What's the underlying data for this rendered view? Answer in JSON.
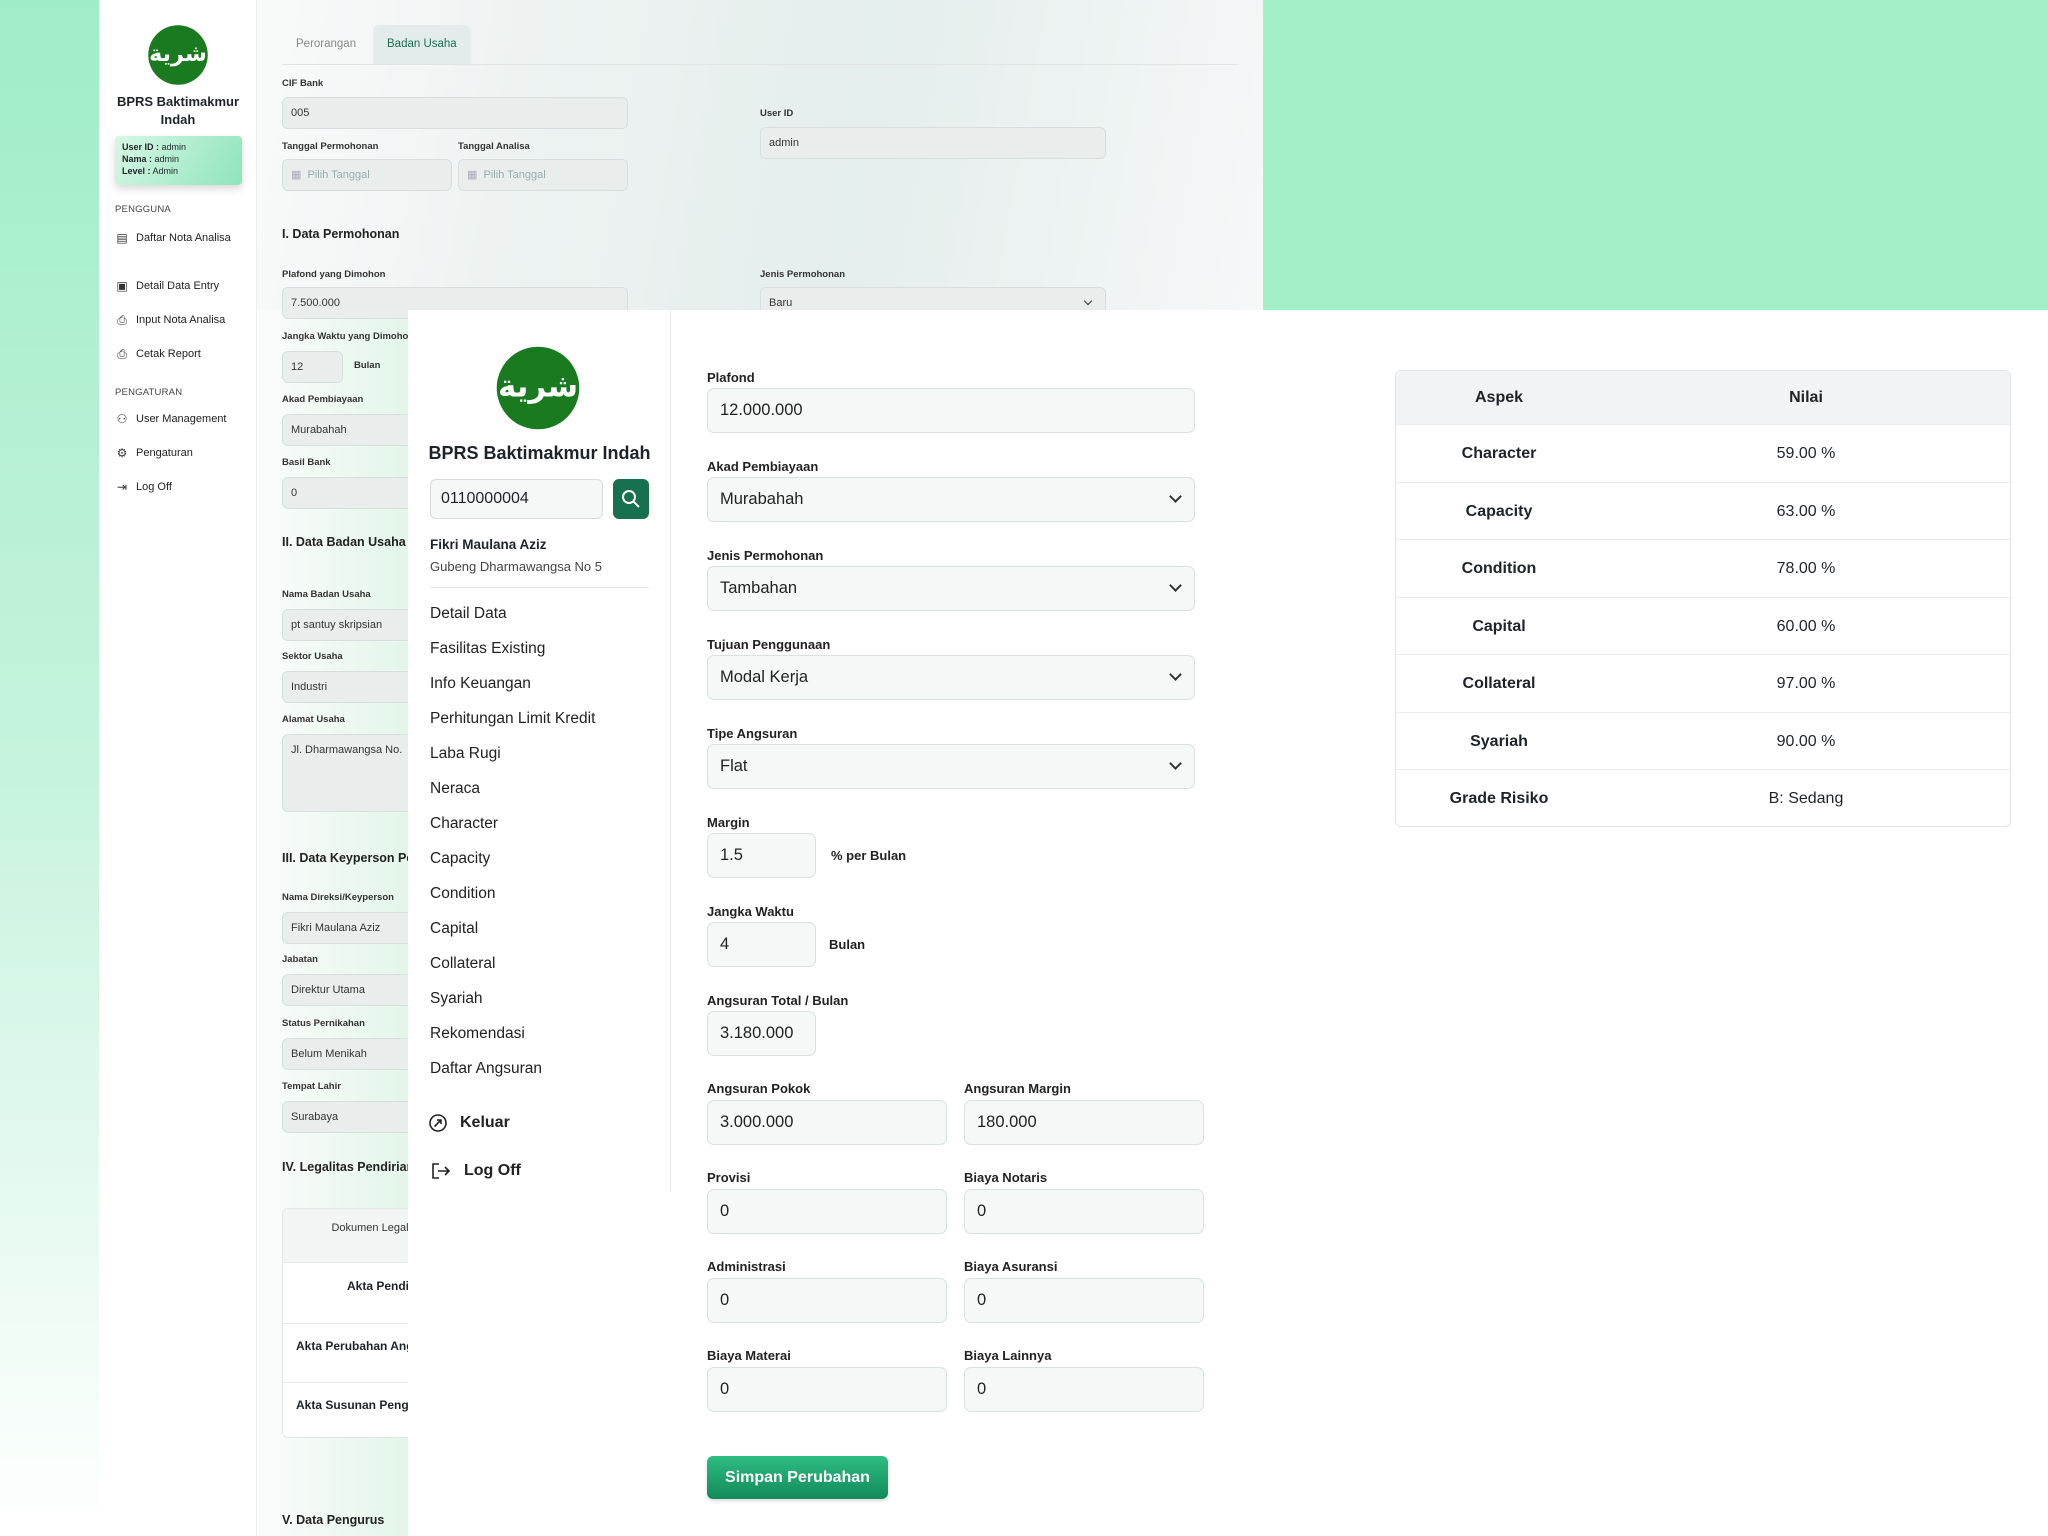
{
  "back_window": {
    "sidebar": {
      "logo_text": "شرية",
      "title": "BPRS Baktimakmur Indah",
      "user_card": {
        "user_id_label": "User ID :",
        "user_id": "admin",
        "nama_label": "Nama :",
        "nama": "admin",
        "level_label": "Level :",
        "level": "Admin"
      },
      "section_pengguna": "PENGGUNA",
      "section_pengaturan": "PENGATURAN",
      "items": [
        {
          "label": "Daftar Nota Analisa",
          "icon": "clipboard-icon"
        },
        {
          "label": "Detail Data Entry",
          "icon": "id-card-icon"
        },
        {
          "label": "Input Nota Analisa",
          "icon": "file-plus-icon"
        },
        {
          "label": "Cetak Report",
          "icon": "printer-icon"
        },
        {
          "label": "User Management",
          "icon": "users-icon"
        },
        {
          "label": "Pengaturan",
          "icon": "gear-icon"
        },
        {
          "label": "Log Off",
          "icon": "logout-icon"
        }
      ]
    },
    "tabs": [
      {
        "label": "Perorangan",
        "active": false
      },
      {
        "label": "Badan Usaha",
        "active": true
      }
    ],
    "cif_bank": {
      "label": "CIF Bank",
      "value": "005"
    },
    "user_id": {
      "label": "User ID",
      "value": "admin"
    },
    "tanggal_permohonan": {
      "label": "Tanggal Permohonan",
      "placeholder": "Pilih Tanggal"
    },
    "tanggal_analisa": {
      "label": "Tanggal Analisa",
      "placeholder": "Pilih Tanggal"
    },
    "section1": "I. Data Permohonan",
    "plafond": {
      "label": "Plafond yang Dimohon",
      "value": "7.500.000"
    },
    "jenis_permohonan": {
      "label": "Jenis Permohonan",
      "value": "Baru"
    },
    "jangka_waktu": {
      "label": "Jangka Waktu yang Dimohon",
      "value": "12",
      "suffix": "Bulan"
    },
    "akad": {
      "label": "Akad Pembiayaan",
      "value": "Murabahah"
    },
    "basil": {
      "label": "Basil Bank",
      "value": "0"
    },
    "section2": "II. Data Badan Usaha",
    "nama_badan": {
      "label": "Nama Badan Usaha",
      "value": "pt santuy skripsian"
    },
    "sektor": {
      "label": "Sektor Usaha",
      "value": "Industri"
    },
    "alamat": {
      "label": "Alamat Usaha",
      "value": "Jl. Dharmawangsa No."
    },
    "section3": "III. Data Keyperson Pe",
    "nama_direksi": {
      "label": "Nama Direksi/Keyperson",
      "value": "Fikri Maulana Aziz"
    },
    "jabatan": {
      "label": "Jabatan",
      "value": "Direktur Utama"
    },
    "status": {
      "label": "Status Pernikahan",
      "value": "Belum Menikah"
    },
    "tempat_lahir": {
      "label": "Tempat Lahir",
      "value": "Surabaya"
    },
    "section4": "IV. Legalitas Pendirian",
    "legal_table": {
      "header": "Dokumen Legalitas Pe Usaha",
      "rows": [
        "Akta Pendirian",
        "Akta Perubahan Anggaran",
        "Akta Susunan Pengurus"
      ]
    },
    "section5": "V. Data Pengurus"
  },
  "front_window": {
    "sidebar": {
      "logo_text": "شرية",
      "title": "BPRS Baktimakmur Indah",
      "search_value": "0110000004",
      "customer_name": "Fikri Maulana Aziz",
      "customer_address": "Gubeng Dharmawangsa No 5",
      "menu": [
        "Detail Data",
        "Fasilitas Existing",
        "Info Keuangan",
        "Perhitungan Limit Kredit",
        "Laba Rugi",
        "Neraca",
        "Character",
        "Capacity",
        "Condition",
        "Capital",
        "Collateral",
        "Syariah",
        "Rekomendasi",
        "Daftar Angsuran"
      ],
      "keluar": "Keluar",
      "logoff": "Log Off"
    },
    "form": {
      "plafond": {
        "label": "Plafond",
        "value": "12.000.000"
      },
      "akad": {
        "label": "Akad Pembiayaan",
        "value": "Murabahah"
      },
      "jenis": {
        "label": "Jenis Permohonan",
        "value": "Tambahan"
      },
      "tujuan": {
        "label": "Tujuan Penggunaan",
        "value": "Modal Kerja"
      },
      "tipe": {
        "label": "Tipe Angsuran",
        "value": "Flat"
      },
      "margin": {
        "label": "Margin",
        "value": "1.5",
        "suffix": "% per Bulan"
      },
      "jangka": {
        "label": "Jangka Waktu",
        "value": "4",
        "suffix": "Bulan"
      },
      "total": {
        "label": "Angsuran Total / Bulan",
        "value": "3.180.000"
      },
      "pokok": {
        "label": "Angsuran Pokok",
        "value": "3.000.000"
      },
      "margin_amt": {
        "label": "Angsuran Margin",
        "value": "180.000"
      },
      "provisi": {
        "label": "Provisi",
        "value": "0"
      },
      "notaris": {
        "label": "Biaya Notaris",
        "value": "0"
      },
      "administrasi": {
        "label": "Administrasi",
        "value": "0"
      },
      "asuransi": {
        "label": "Biaya Asuransi",
        "value": "0"
      },
      "materai": {
        "label": "Biaya Materai",
        "value": "0"
      },
      "lainnya": {
        "label": "Biaya Lainnya",
        "value": "0"
      },
      "save_label": "Simpan Perubahan"
    },
    "score_table": {
      "headers": [
        "Aspek",
        "Nilai"
      ],
      "rows": [
        {
          "aspek": "Character",
          "nilai": "59.00 %"
        },
        {
          "aspek": "Capacity",
          "nilai": "63.00 %"
        },
        {
          "aspek": "Condition",
          "nilai": "78.00 %"
        },
        {
          "aspek": "Capital",
          "nilai": "60.00 %"
        },
        {
          "aspek": "Collateral",
          "nilai": "97.00 %"
        },
        {
          "aspek": "Syariah",
          "nilai": "90.00 %"
        },
        {
          "aspek": "Grade Risiko",
          "nilai": "B: Sedang"
        }
      ]
    }
  },
  "colors": {
    "brand_green": "#17704f",
    "logo_green": "#1a7a1f",
    "bg_mint": "#a2efc8"
  }
}
